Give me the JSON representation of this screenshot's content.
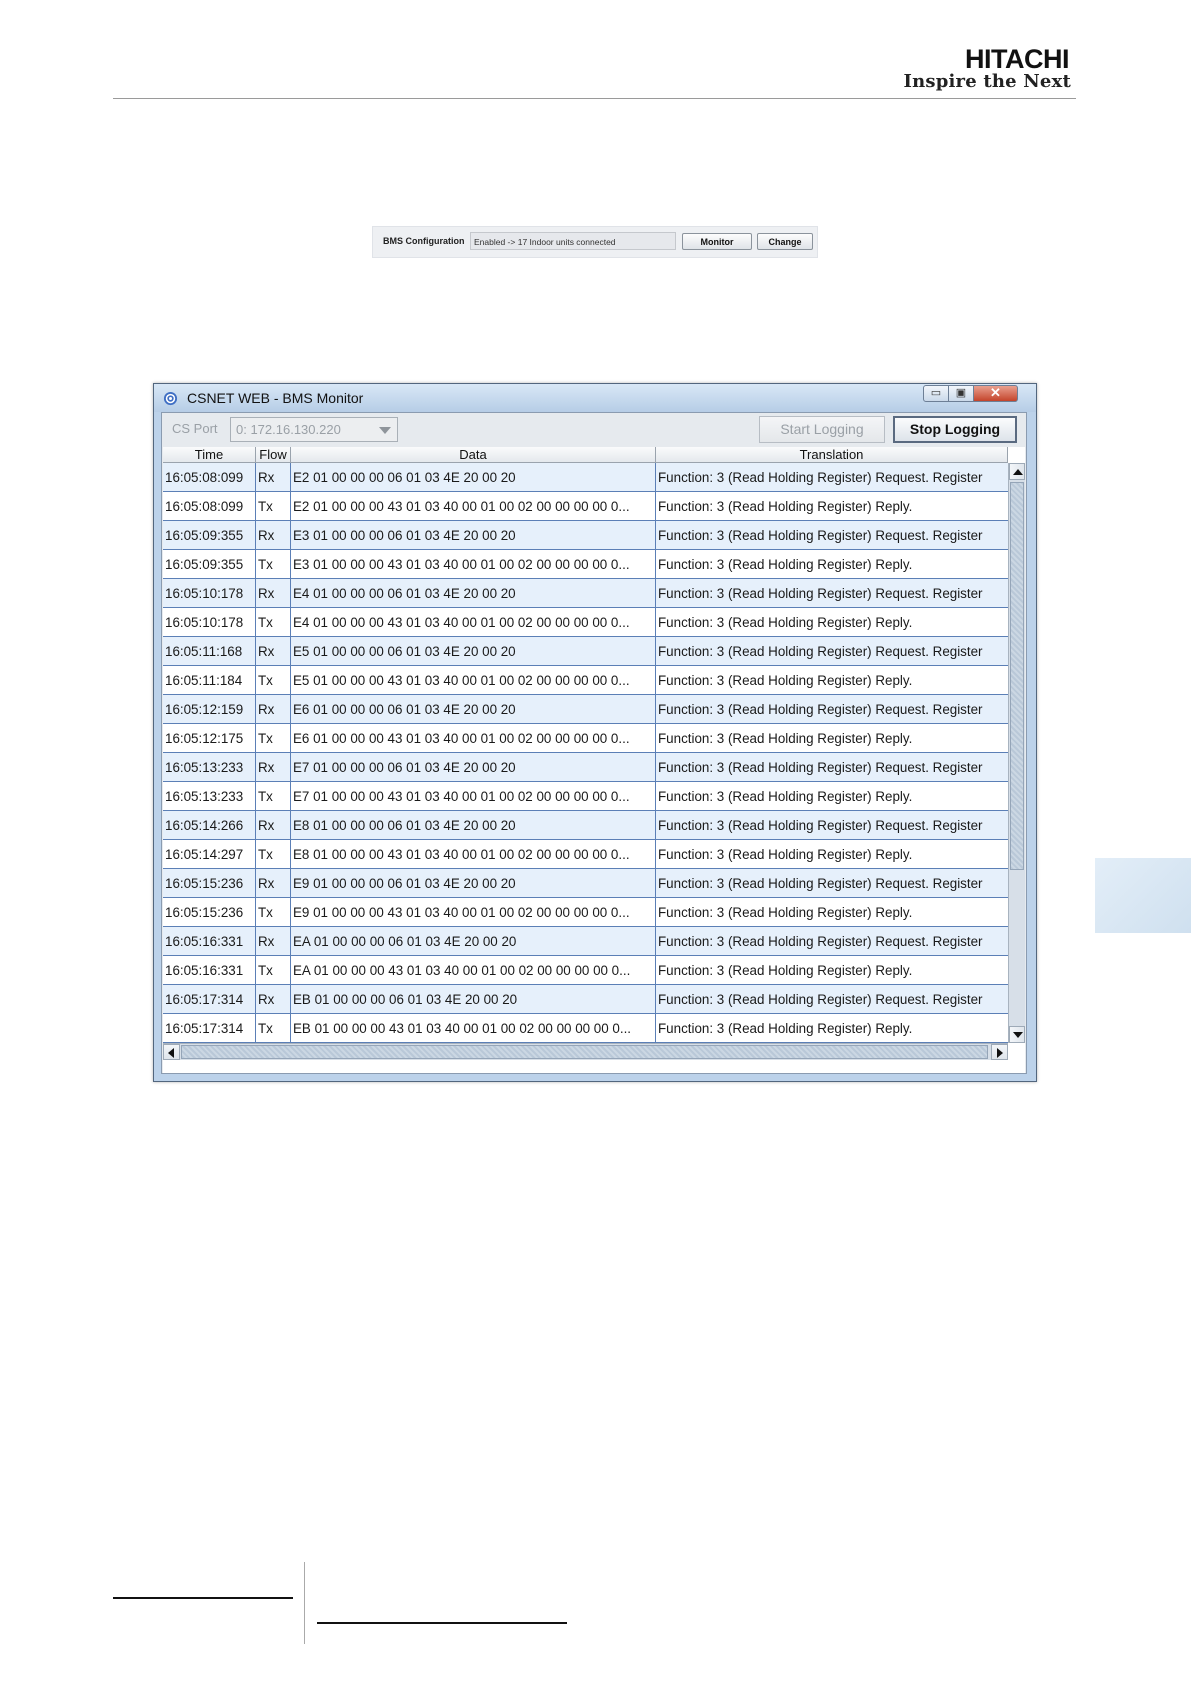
{
  "header": {
    "brand": "HITACHI",
    "slogan": "Inspire the Next"
  },
  "bms_bar": {
    "label": "BMS Configuration",
    "status": "Enabled -> 17 Indoor units connected",
    "monitor_label": "Monitor",
    "change_label": "Change"
  },
  "window": {
    "title": "CSNET WEB - BMS Monitor",
    "minimize_glyph": "▭",
    "maximize_glyph": "▣",
    "close_glyph": "✕",
    "cs_port_label": "CS Port",
    "cs_port_value": "0: 172.16.130.220",
    "start_logging_label": "Start Logging",
    "stop_logging_label": "Stop Logging"
  },
  "table": {
    "columns": [
      "Time",
      "Flow",
      "Data",
      "Translation"
    ],
    "rows": [
      {
        "time": "16:05:08:099",
        "flow": "Rx",
        "data": "E2 01 00 00 00 06 01 03 4E 20 00 20",
        "translation": "Function: 3 (Read Holding Register) Request. Register"
      },
      {
        "time": "16:05:08:099",
        "flow": "Tx",
        "data": "E2 01 00 00 00 43 01 03 40 00 01 00 02 00 00 00 00 0...",
        "translation": "Function: 3 (Read Holding Register) Reply."
      },
      {
        "time": "16:05:09:355",
        "flow": "Rx",
        "data": "E3 01 00 00 00 06 01 03 4E 20 00 20",
        "translation": "Function: 3 (Read Holding Register) Request. Register"
      },
      {
        "time": "16:05:09:355",
        "flow": "Tx",
        "data": "E3 01 00 00 00 43 01 03 40 00 01 00 02 00 00 00 00 0...",
        "translation": "Function: 3 (Read Holding Register) Reply."
      },
      {
        "time": "16:05:10:178",
        "flow": "Rx",
        "data": "E4 01 00 00 00 06 01 03 4E 20 00 20",
        "translation": "Function: 3 (Read Holding Register) Request. Register"
      },
      {
        "time": "16:05:10:178",
        "flow": "Tx",
        "data": "E4 01 00 00 00 43 01 03 40 00 01 00 02 00 00 00 00 0...",
        "translation": "Function: 3 (Read Holding Register) Reply."
      },
      {
        "time": "16:05:11:168",
        "flow": "Rx",
        "data": "E5 01 00 00 00 06 01 03 4E 20 00 20",
        "translation": "Function: 3 (Read Holding Register) Request. Register"
      },
      {
        "time": "16:05:11:184",
        "flow": "Tx",
        "data": "E5 01 00 00 00 43 01 03 40 00 01 00 02 00 00 00 00 0...",
        "translation": "Function: 3 (Read Holding Register) Reply."
      },
      {
        "time": "16:05:12:159",
        "flow": "Rx",
        "data": "E6 01 00 00 00 06 01 03 4E 20 00 20",
        "translation": "Function: 3 (Read Holding Register) Request. Register"
      },
      {
        "time": "16:05:12:175",
        "flow": "Tx",
        "data": "E6 01 00 00 00 43 01 03 40 00 01 00 02 00 00 00 00 0...",
        "translation": "Function: 3 (Read Holding Register) Reply."
      },
      {
        "time": "16:05:13:233",
        "flow": "Rx",
        "data": "E7 01 00 00 00 06 01 03 4E 20 00 20",
        "translation": "Function: 3 (Read Holding Register) Request. Register"
      },
      {
        "time": "16:05:13:233",
        "flow": "Tx",
        "data": "E7 01 00 00 00 43 01 03 40 00 01 00 02 00 00 00 00 0...",
        "translation": "Function: 3 (Read Holding Register) Reply."
      },
      {
        "time": "16:05:14:266",
        "flow": "Rx",
        "data": "E8 01 00 00 00 06 01 03 4E 20 00 20",
        "translation": "Function: 3 (Read Holding Register) Request. Register"
      },
      {
        "time": "16:05:14:297",
        "flow": "Tx",
        "data": "E8 01 00 00 00 43 01 03 40 00 01 00 02 00 00 00 00 0...",
        "translation": "Function: 3 (Read Holding Register) Reply."
      },
      {
        "time": "16:05:15:236",
        "flow": "Rx",
        "data": "E9 01 00 00 00 06 01 03 4E 20 00 20",
        "translation": "Function: 3 (Read Holding Register) Request. Register"
      },
      {
        "time": "16:05:15:236",
        "flow": "Tx",
        "data": "E9 01 00 00 00 43 01 03 40 00 01 00 02 00 00 00 00 0...",
        "translation": "Function: 3 (Read Holding Register) Reply."
      },
      {
        "time": "16:05:16:331",
        "flow": "Rx",
        "data": "EA 01 00 00 00 06 01 03 4E 20 00 20",
        "translation": "Function: 3 (Read Holding Register) Request. Register"
      },
      {
        "time": "16:05:16:331",
        "flow": "Tx",
        "data": "EA 01 00 00 00 43 01 03 40 00 01 00 02 00 00 00 00 0...",
        "translation": "Function: 3 (Read Holding Register) Reply."
      },
      {
        "time": "16:05:17:314",
        "flow": "Rx",
        "data": "EB 01 00 00 00 06 01 03 4E 20 00 20",
        "translation": "Function: 3 (Read Holding Register) Request. Register"
      },
      {
        "time": "16:05:17:314",
        "flow": "Tx",
        "data": "EB 01 00 00 00 43 01 03 40 00 01 00 02 00 00 00 00 0...",
        "translation": "Function: 3 (Read Holding Register) Reply."
      }
    ]
  },
  "icons": {
    "window_icon": "app-gear-icon",
    "select_arrow": "chevron-down-icon"
  },
  "colors": {
    "rx_row": "#e6f0fb",
    "tx_row": "#ffffff",
    "grid_line": "#5b7fb6"
  }
}
